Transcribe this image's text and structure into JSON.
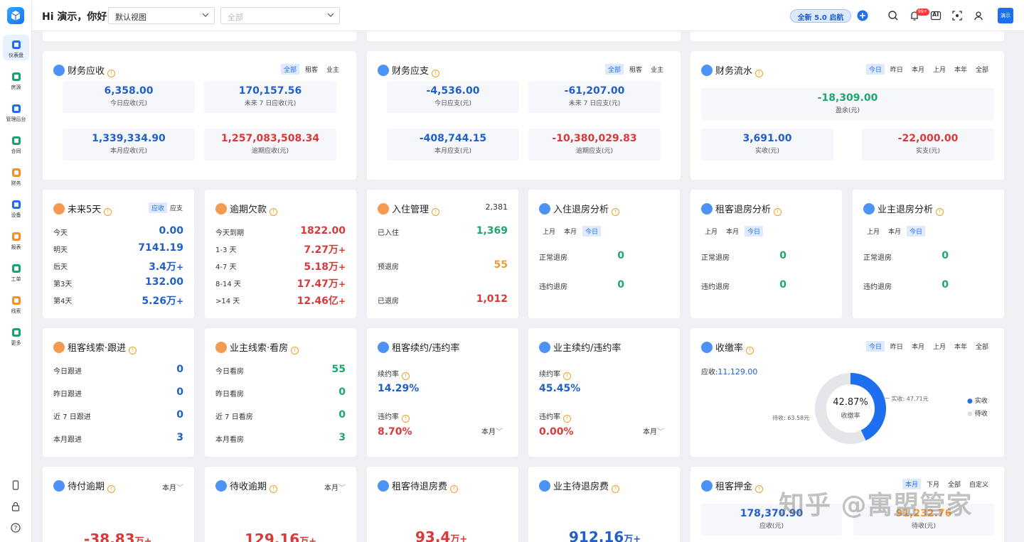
{
  "app": {
    "avatar_text": "演示"
  },
  "sidebar": {
    "items": [
      {
        "label": "仪表盘",
        "icon": "dashboard-icon",
        "active": true
      },
      {
        "label": "房源",
        "icon": "house-icon"
      },
      {
        "label": "管理后台",
        "icon": "admin-icon"
      },
      {
        "label": "合同",
        "icon": "contract-icon"
      },
      {
        "label": "财务",
        "icon": "finance-icon"
      },
      {
        "label": "设备",
        "icon": "device-icon"
      },
      {
        "label": "报表",
        "icon": "report-icon"
      },
      {
        "label": "工单",
        "icon": "workorder-icon"
      },
      {
        "label": "线索",
        "icon": "leads-icon"
      },
      {
        "label": "更多",
        "icon": "more-icon"
      }
    ]
  },
  "header": {
    "greeting": "Hi 演示，你好~",
    "view_select": "默认视图",
    "scope_placeholder": "全部",
    "upgrade_label": "全新 5.0 启航",
    "bell_badge": "99+",
    "ai_label": "AI"
  },
  "finance_receivable": {
    "title": "财务应收",
    "tabs": [
      "全部",
      "租客",
      "业主"
    ],
    "active_tab": 0,
    "stats": [
      {
        "value": "6,358.00",
        "label": "今日应收(元)"
      },
      {
        "value": "170,157.56",
        "label": "未来 7 日应收(元)"
      },
      {
        "value": "1,339,334.90",
        "label": "本月应收(元)"
      },
      {
        "value": "1,257,083,508.34",
        "label": "逾期应收(元)"
      }
    ]
  },
  "finance_payable": {
    "title": "财务应支",
    "tabs": [
      "全部",
      "租客",
      "业主"
    ],
    "active_tab": 0,
    "stats": [
      {
        "value": "-4,536.00",
        "label": "今日应支(元)"
      },
      {
        "value": "-61,207.00",
        "label": "未来 7 日应支(元)"
      },
      {
        "value": "-408,744.15",
        "label": "本月应支(元)"
      },
      {
        "value": "-10,380,029.83",
        "label": "逾期应支(元)"
      }
    ]
  },
  "finance_flow": {
    "title": "财务流水",
    "tabs": [
      "今日",
      "昨日",
      "本月",
      "上月",
      "本年",
      "全部"
    ],
    "active_tab": 0,
    "surplus": {
      "value": "-18,309.00",
      "label": "盈余(元)"
    },
    "received": {
      "value": "3,691.00",
      "label": "实收(元)"
    },
    "paid": {
      "value": "-22,000.00",
      "label": "实支(元)"
    }
  },
  "next5": {
    "title": "未来5天",
    "tabs": [
      "应收",
      "应支"
    ],
    "rows": [
      {
        "label": "今天",
        "value": "0.00",
        "suffix": ""
      },
      {
        "label": "明天",
        "value": "7141.19",
        "suffix": ""
      },
      {
        "label": "后天",
        "value": "3.4万",
        "suffix": "+"
      },
      {
        "label": "第3天",
        "value": "132.00",
        "suffix": ""
      },
      {
        "label": "第4天",
        "value": "5.26万",
        "suffix": "+"
      }
    ]
  },
  "overdue": {
    "title": "逾期欠款",
    "rows": [
      {
        "label": "今天到期",
        "value": "1822.00",
        "suffix": ""
      },
      {
        "label": "1-3 天",
        "value": "7.27万",
        "suffix": "+"
      },
      {
        "label": "4-7 天",
        "value": "5.18万",
        "suffix": "+"
      },
      {
        "label": "8-14 天",
        "value": "17.47万",
        "suffix": "+"
      },
      {
        "label": ">14 天",
        "value": "12.46亿",
        "suffix": "+"
      }
    ]
  },
  "checkin": {
    "title": "入住管理",
    "total": "2,381",
    "rows": [
      {
        "label": "已入住",
        "value": "1,369"
      },
      {
        "label": "预退房",
        "value": "55"
      },
      {
        "label": "已退房",
        "value": "1,012"
      }
    ]
  },
  "checkout_analysis": [
    {
      "title": "入住退房分析",
      "tabs": [
        "上月",
        "本月",
        "今日"
      ],
      "active_tab": 2,
      "rows": [
        {
          "label": "正常退房",
          "value": "0"
        },
        {
          "label": "违约退房",
          "value": "0"
        }
      ]
    },
    {
      "title": "租客退房分析",
      "tabs": [
        "上月",
        "本月",
        "今日"
      ],
      "active_tab": 2,
      "rows": [
        {
          "label": "正常退房",
          "value": "0"
        },
        {
          "label": "违约退房",
          "value": "0"
        }
      ]
    },
    {
      "title": "业主退房分析",
      "tabs": [
        "上月",
        "本月",
        "今日"
      ],
      "active_tab": 2,
      "rows": [
        {
          "label": "正常退房",
          "value": "0"
        },
        {
          "label": "违约退房",
          "value": "0"
        }
      ]
    }
  ],
  "tenant_leads": {
    "title": "租客线索·跟进",
    "rows": [
      {
        "label": "今日跟进",
        "value": "0"
      },
      {
        "label": "昨日跟进",
        "value": "0"
      },
      {
        "label": "近 7 日跟进",
        "value": "0"
      },
      {
        "label": "本月跟进",
        "value": "3"
      }
    ]
  },
  "owner_leads": {
    "title": "业主线索·看房",
    "rows": [
      {
        "label": "今日看房",
        "value": "55"
      },
      {
        "label": "昨日看房",
        "value": "0"
      },
      {
        "label": "近 7 日看房",
        "value": "0"
      },
      {
        "label": "本月看房",
        "value": "3"
      }
    ]
  },
  "tenant_renew": {
    "title": "租客续约/违约率",
    "renew_label": "续约率",
    "renew_value": "14.29%",
    "breach_label": "违约率",
    "breach_value": "8.70%",
    "period": "本月"
  },
  "owner_renew": {
    "title": "业主续约/违约率",
    "renew_label": "续约率",
    "renew_value": "45.45%",
    "breach_label": "违约率",
    "breach_value": "0.00%",
    "period": "本月"
  },
  "collection": {
    "title": "收缴率",
    "tabs": [
      "今日",
      "昨日",
      "本月",
      "上月",
      "本年",
      "全部"
    ],
    "active_tab": 0,
    "receivable_label": "应收:",
    "receivable_value": "11,129.00",
    "center_value": "42.87%",
    "center_label": "收缴率",
    "received_callout": "实收: 47.71元",
    "pending_callout": "待收: 63.58元",
    "fraction": 0.4287,
    "legend": [
      {
        "name": "实收",
        "color": "#1e6ff0"
      },
      {
        "name": "待收",
        "color": "#e5e6ea"
      }
    ]
  },
  "pay_overdue": {
    "title": "待付逾期",
    "period": "本月",
    "value": "-38.83",
    "unit": "万+"
  },
  "collect_overdue": {
    "title": "待收逾期",
    "period": "本月",
    "value": "129.16",
    "unit": "万+"
  },
  "tenant_refund": {
    "title": "租客待退房费",
    "value": "93.4",
    "unit": "万+"
  },
  "owner_refund": {
    "title": "业主待退房费",
    "value": "912.16",
    "unit": "万+"
  },
  "deposit": {
    "title": "租客押金",
    "tabs": [
      "本月",
      "下月",
      "全部",
      "自定义"
    ],
    "active_tab": 0,
    "received": {
      "value": "178,370.90",
      "label": "应收(元)"
    },
    "pending": {
      "value": "91,232.76",
      "label": "待收(元)"
    }
  },
  "watermark": "知乎 @寓盟管家"
}
